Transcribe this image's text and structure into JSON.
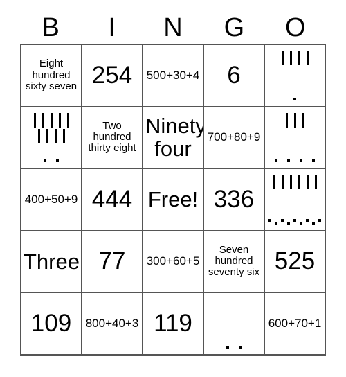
{
  "card": {
    "title_letters": [
      "B",
      "I",
      "N",
      "G",
      "O"
    ],
    "columns": 5,
    "rows": 5,
    "free_space_label": "Free!",
    "border_color": "#555555",
    "text_color": "#000000",
    "background_color": "#ffffff",
    "grid": [
      [
        {
          "type": "text",
          "value": "Eight hundred sixty seven",
          "size": "sm"
        },
        {
          "type": "text",
          "value": "254",
          "size": "xl"
        },
        {
          "type": "text",
          "value": "500+30+4",
          "size": "md"
        },
        {
          "type": "text",
          "value": "6",
          "size": "xl"
        },
        {
          "type": "marks",
          "value": "4 tallies, 1 dot",
          "tallies": [
            4
          ],
          "dots": [
            1
          ]
        }
      ],
      [
        {
          "type": "marks",
          "value": "9 tallies, 2 dots",
          "tallies": [
            5,
            4
          ],
          "dots": [
            2
          ]
        },
        {
          "type": "text",
          "value": "Two hundred thirty eight",
          "size": "sm"
        },
        {
          "type": "text",
          "value": "Ninety four",
          "size": "lg"
        },
        {
          "type": "text",
          "value": "700+80+9",
          "size": "md"
        },
        {
          "type": "marks",
          "value": "3 tallies, 4 dots",
          "tallies": [
            3
          ],
          "dots": [
            4
          ]
        }
      ],
      [
        {
          "type": "text",
          "value": "400+50+9",
          "size": "md"
        },
        {
          "type": "text",
          "value": "444",
          "size": "xl"
        },
        {
          "type": "text",
          "value": "Free!",
          "size": "lg"
        },
        {
          "type": "text",
          "value": "336",
          "size": "xl"
        },
        {
          "type": "marks",
          "value": "6 tallies, 9 dots",
          "tallies": [
            6
          ],
          "dots": [
            5,
            4
          ]
        }
      ],
      [
        {
          "type": "text",
          "value": "Three",
          "size": "lg"
        },
        {
          "type": "text",
          "value": "77",
          "size": "xl"
        },
        {
          "type": "text",
          "value": "300+60+5",
          "size": "md"
        },
        {
          "type": "text",
          "value": "Seven hundred seventy six",
          "size": "sm"
        },
        {
          "type": "text",
          "value": "525",
          "size": "xl"
        }
      ],
      [
        {
          "type": "text",
          "value": "109",
          "size": "xl"
        },
        {
          "type": "text",
          "value": "800+40+3",
          "size": "md"
        },
        {
          "type": "text",
          "value": "119",
          "size": "xl"
        },
        {
          "type": "marks",
          "value": "2 dots",
          "tallies": [],
          "dots": [
            2
          ]
        },
        {
          "type": "text",
          "value": "600+70+1",
          "size": "md"
        }
      ]
    ]
  }
}
